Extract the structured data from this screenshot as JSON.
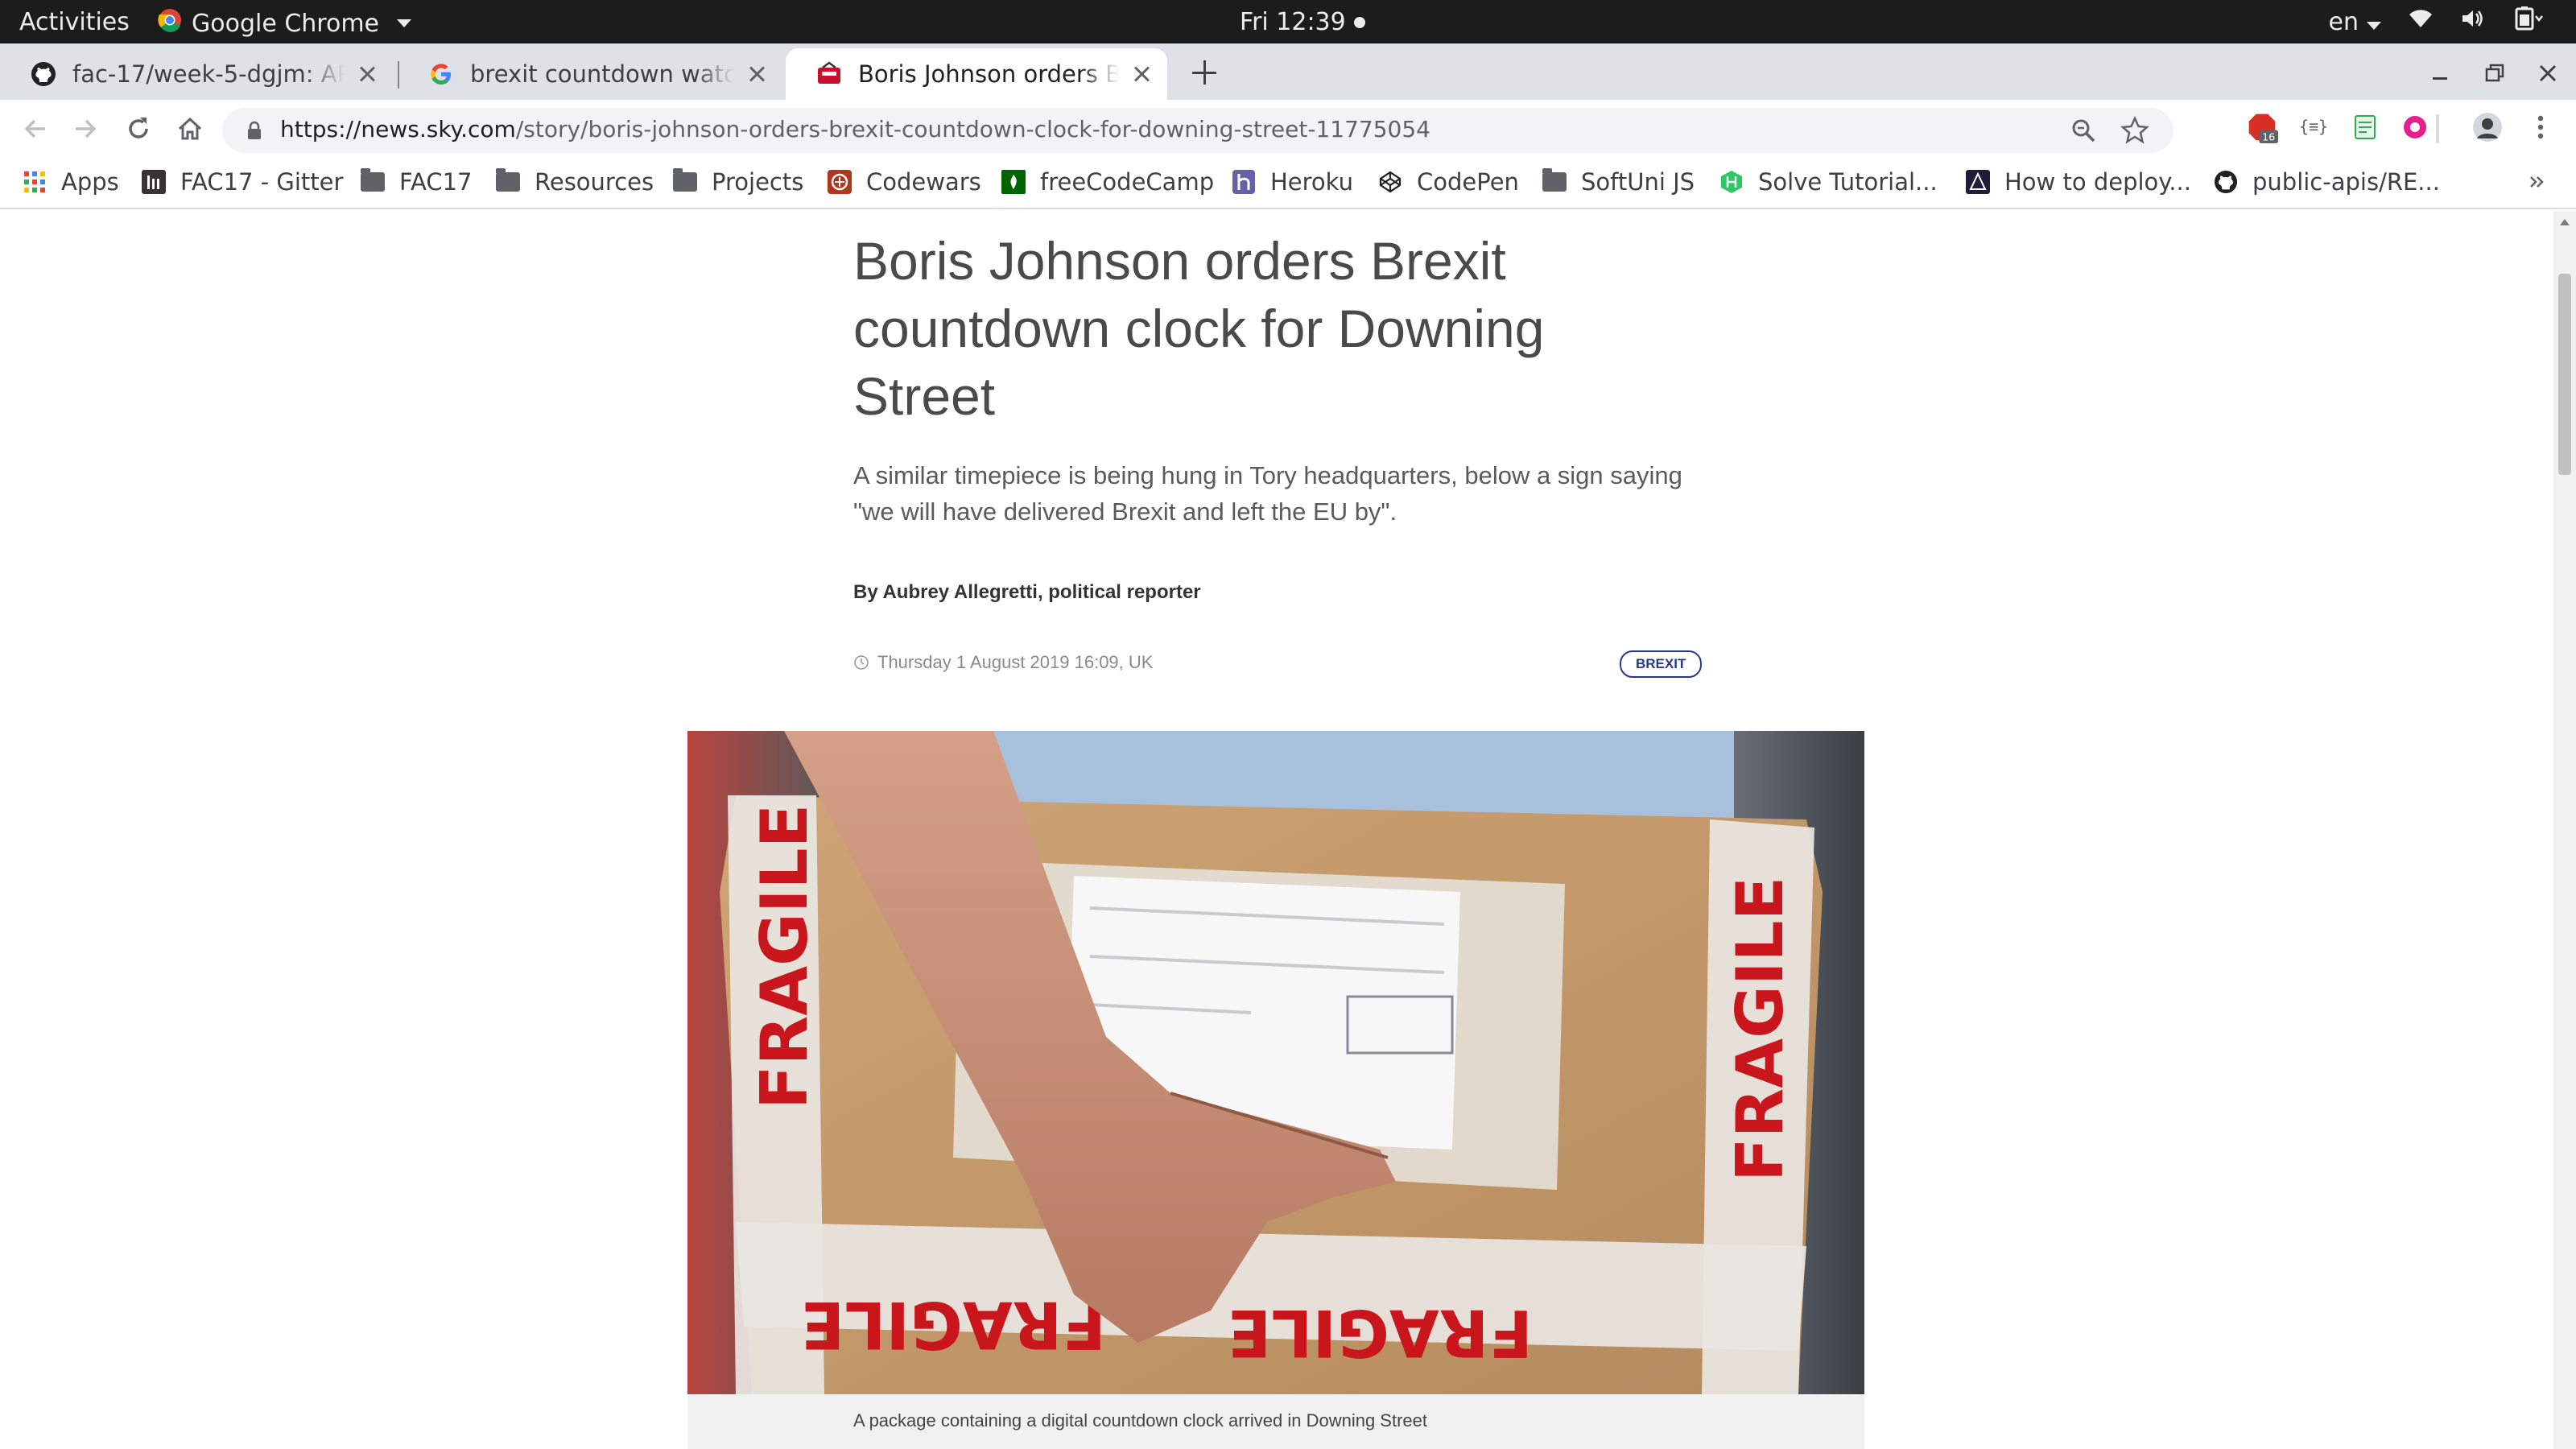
{
  "system_bar": {
    "activities": "Activities",
    "app_name": "Google Chrome",
    "clock": "Fri 12:39",
    "language": "en",
    "icons": [
      "wifi-icon",
      "volume-icon",
      "battery-icon"
    ]
  },
  "tabs": [
    {
      "title": "fac-17/week-5-dgjm: API t",
      "icon": "github-icon"
    },
    {
      "title": "brexit countdown watch c",
      "icon": "google-icon"
    },
    {
      "title": "Boris Johnson orders Bre",
      "icon": "sky-news-icon",
      "active": true
    }
  ],
  "address_bar": {
    "host": "https://news.sky.com",
    "path": "/story/boris-johnson-orders-brexit-countdown-clock-for-downing-street-11775054"
  },
  "extensions": {
    "badge_count": "16"
  },
  "bookmarks": [
    {
      "label": "Apps",
      "icon": "apps-grid-icon"
    },
    {
      "label": "FAC17 - Gitter",
      "icon": "gitter-icon"
    },
    {
      "label": "FAC17",
      "icon": "folder-icon"
    },
    {
      "label": "Resources",
      "icon": "folder-icon"
    },
    {
      "label": "Projects",
      "icon": "folder-icon"
    },
    {
      "label": "Codewars",
      "icon": "codewars-icon"
    },
    {
      "label": "freeCodeCamp",
      "icon": "freecodecamp-icon"
    },
    {
      "label": "Heroku",
      "icon": "heroku-icon"
    },
    {
      "label": "CodePen",
      "icon": "codepen-icon"
    },
    {
      "label": "SoftUni JS",
      "icon": "folder-icon"
    },
    {
      "label": "Solve Tutorial...",
      "icon": "hackerrank-icon"
    },
    {
      "label": "How to deploy...",
      "icon": "deploy-icon"
    },
    {
      "label": "public-apis/RE...",
      "icon": "github-icon"
    }
  ],
  "article": {
    "headline": "Boris Johnson orders Brexit countdown clock for Downing Street",
    "standfirst": "A similar timepiece is being hung in Tory headquarters, below a sign saying \"we will have delivered Brexit and left the EU by\".",
    "byline": "By Aubrey Allegretti, political reporter",
    "date": "Thursday 1 August 2019 16:09, UK",
    "tag": "BREXIT",
    "image_caption": "A package containing a digital countdown clock arrived in Downing Street",
    "image_box_text": "FRAGILE"
  }
}
